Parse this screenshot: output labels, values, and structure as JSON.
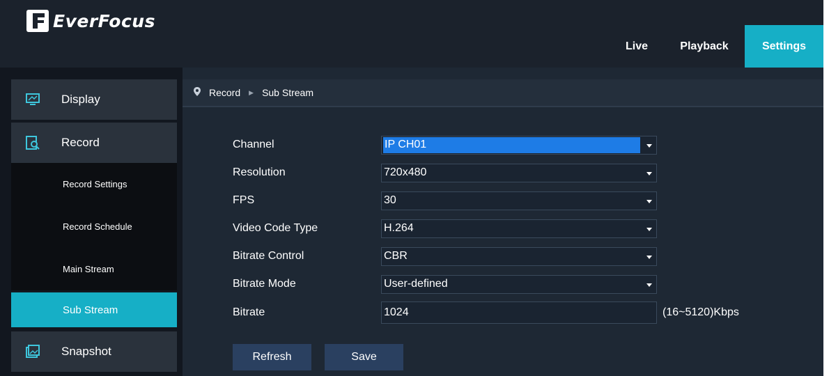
{
  "header": {
    "logo_text": "EverFocus",
    "nav": [
      {
        "label": "Live"
      },
      {
        "label": "Playback"
      },
      {
        "label": "Settings"
      }
    ]
  },
  "sidebar": {
    "display": "Display",
    "record": "Record",
    "sub_items": [
      "Record Settings",
      "Record Schedule",
      "Main Stream",
      "Sub Stream"
    ],
    "snapshot": "Snapshot"
  },
  "breadcrumb": {
    "section": "Record",
    "page": "Sub Stream"
  },
  "form": {
    "channel": {
      "label": "Channel",
      "value": "IP CH01"
    },
    "resolution": {
      "label": "Resolution",
      "value": "720x480"
    },
    "fps": {
      "label": "FPS",
      "value": "30"
    },
    "video_code_type": {
      "label": "Video Code Type",
      "value": "H.264"
    },
    "bitrate_control": {
      "label": "Bitrate Control",
      "value": "CBR"
    },
    "bitrate_mode": {
      "label": "Bitrate Mode",
      "value": "User-defined"
    },
    "bitrate": {
      "label": "Bitrate",
      "value": "1024",
      "range": "(16~5120)Kbps"
    }
  },
  "buttons": {
    "refresh": "Refresh",
    "save": "Save"
  },
  "colors": {
    "accent": "#16afc6",
    "selection": "#1e7ce6",
    "button": "#2a4060"
  },
  "icons": {
    "display": "monitor-icon",
    "record": "record-search-icon",
    "snapshot": "snapshot-icon",
    "breadcrumb": "location-pin-icon",
    "separator": "triangle-right-icon"
  }
}
